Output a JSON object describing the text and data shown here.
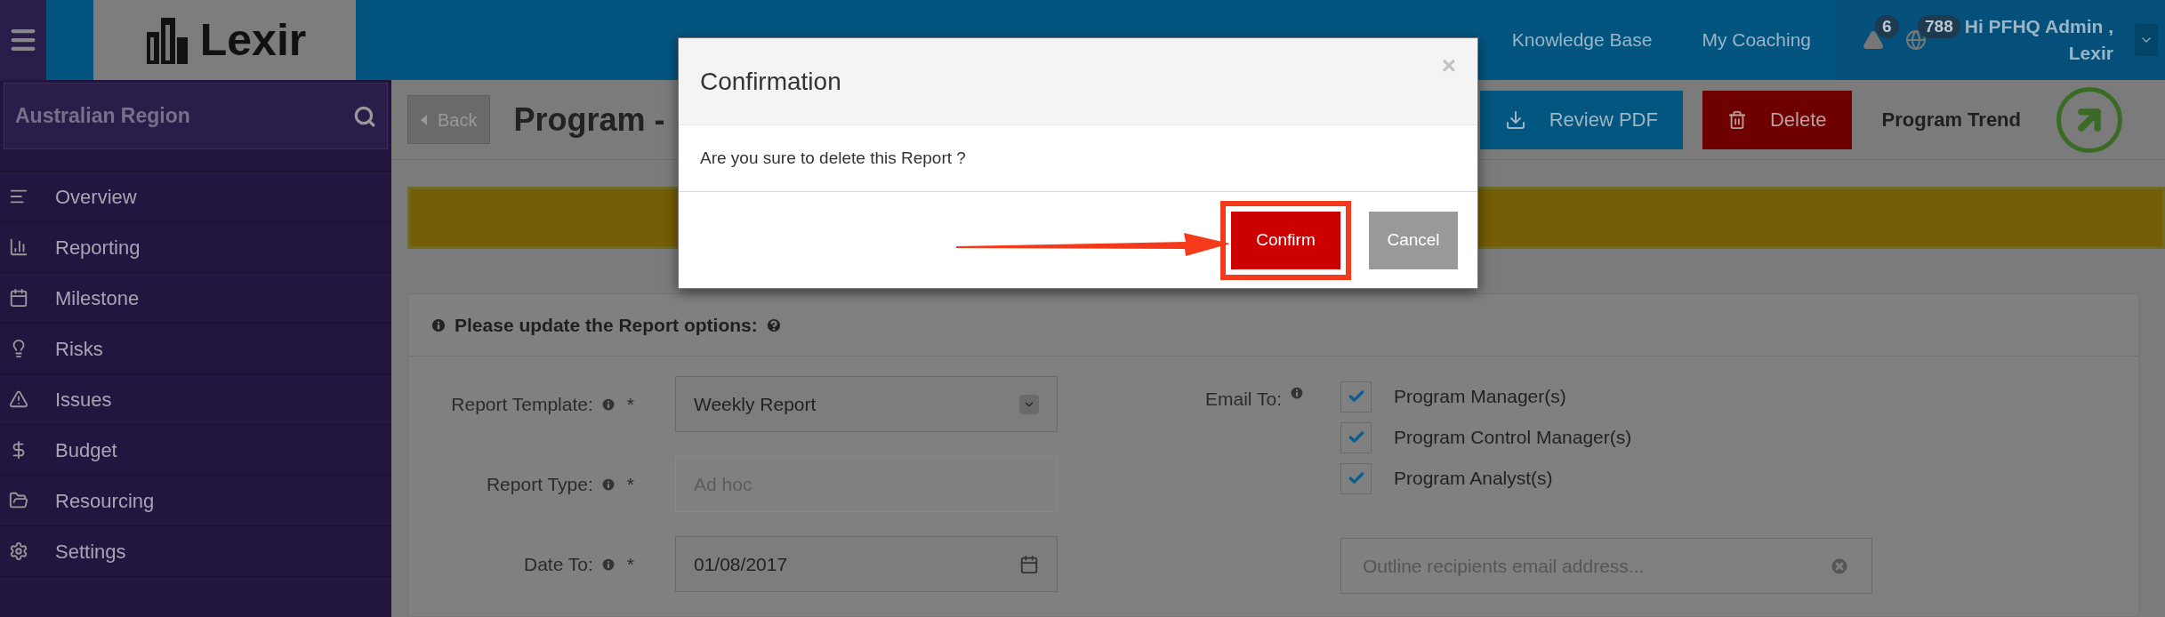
{
  "logo": {
    "text": "Lexir"
  },
  "nav": [
    {
      "label": "Knowledge Base"
    },
    {
      "label": "My Coaching"
    }
  ],
  "notifications": [
    {
      "kind": "alert",
      "count": "6"
    },
    {
      "kind": "globe",
      "count": "788"
    }
  ],
  "user": {
    "greeting": "Hi PFHQ Admin ,",
    "org": "Lexir"
  },
  "sidebar": {
    "search": {
      "value": "Australian Region"
    },
    "items": [
      {
        "label": "Overview"
      },
      {
        "label": "Reporting"
      },
      {
        "label": "Milestone"
      },
      {
        "label": "Risks"
      },
      {
        "label": "Issues"
      },
      {
        "label": "Budget"
      },
      {
        "label": "Resourcing"
      },
      {
        "label": "Settings"
      }
    ]
  },
  "page": {
    "back": "Back",
    "title": "Program -",
    "actions": [
      {
        "label": "Review PDF",
        "kind": "download"
      },
      {
        "label": "Delete",
        "kind": "delete"
      }
    ],
    "trend_label": "Program Trend"
  },
  "form": {
    "heading": "Please update the Report options:",
    "fields": [
      {
        "label": "Report Template:",
        "mark": "*",
        "kind": "select",
        "value": "Weekly Report",
        "disabled": false
      },
      {
        "label": "Report Type:",
        "mark": "*",
        "kind": "text",
        "value": "Ad hoc",
        "disabled": true
      },
      {
        "label": "Date To:",
        "mark": "*",
        "kind": "date",
        "value": "01/08/2017",
        "disabled": false
      }
    ],
    "email": {
      "label": "Email To:",
      "options": [
        {
          "label": "Program Manager(s)",
          "checked": true
        },
        {
          "label": "Program Control Manager(s)",
          "checked": true
        },
        {
          "label": "Program Analyst(s)",
          "checked": true
        }
      ],
      "recipients": {
        "placeholder": "Outline recipients email address..."
      }
    }
  },
  "dialog": {
    "title": "Confirmation",
    "close": "×",
    "message": "Are you sure to delete this Report ?",
    "buttons": [
      {
        "label": "Confirm",
        "kind": "primary",
        "highlighted": true
      },
      {
        "label": "Cancel",
        "kind": "secondary",
        "highlighted": false
      }
    ]
  }
}
